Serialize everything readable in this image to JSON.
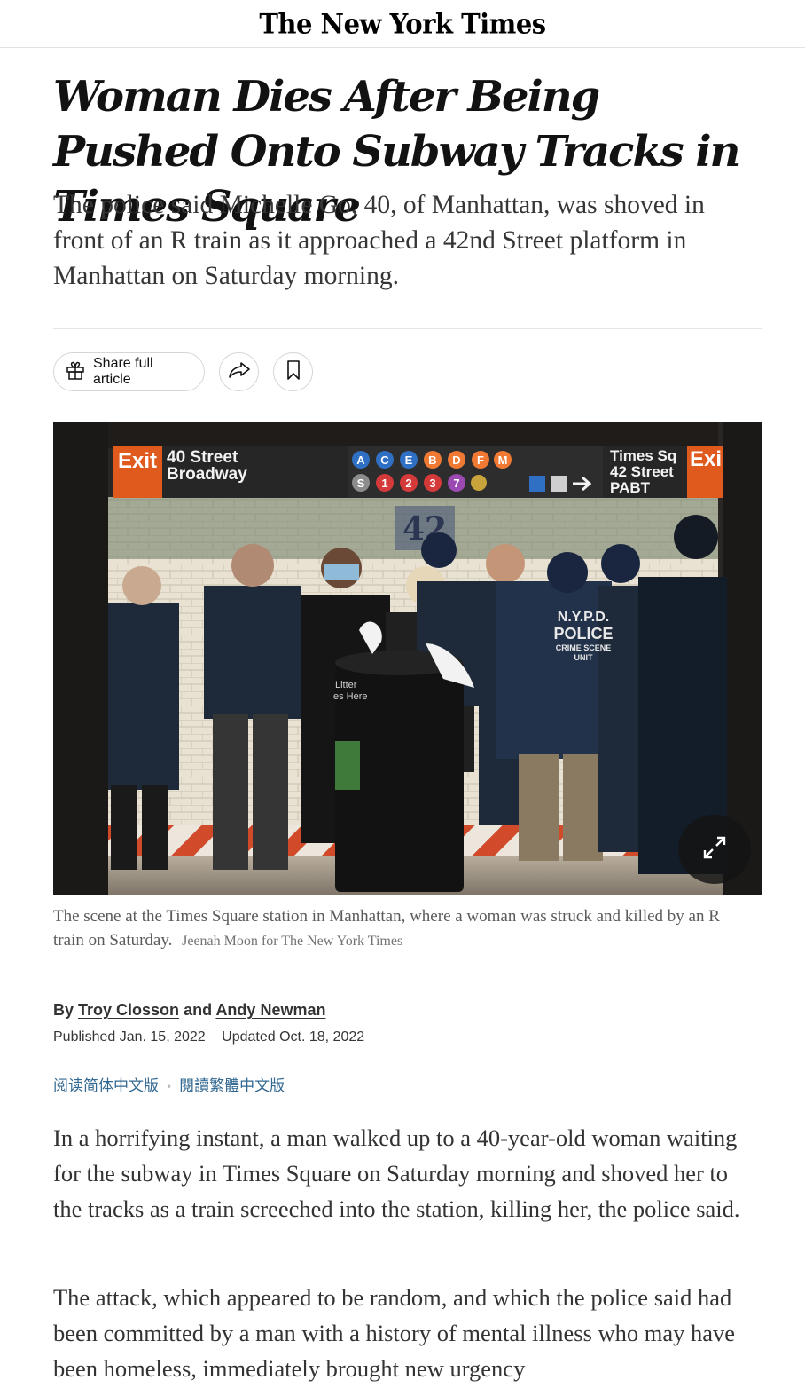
{
  "masthead": {
    "logo_text": "The New York Times"
  },
  "article": {
    "headline": "Woman Dies After Being Pushed Onto Subway Tracks in Times Square",
    "summary": "The police said Michelle Go, 40, of Manhattan, was shoved in front of an R train as it approached a 42nd Street platform in Manhattan on Saturday morning.",
    "caption": "The scene at the Times Square station in Manhattan, where a woman was struck and killed by an R train on Saturday.",
    "credit": "Jeenah Moon for The New York Times",
    "byline": {
      "prefix": "By",
      "author1": "Troy Closson",
      "conj": "and",
      "author2": "Andy Newman"
    },
    "published": "Published Jan. 15, 2022",
    "updated": "Updated Oct. 18, 2022",
    "translations": {
      "simplified": "阅读简体中文版",
      "traditional": "閱讀繁體中文版"
    },
    "paragraphs": [
      "In a horrifying instant, a man walked up to a 40-year-old woman waiting for the subway in Times Square on Saturday morning and shoved her to the tracks as a train screeched into the station, killing her, the police said.",
      "The attack, which appeared to be random, and which the police said had been committed by a man with a history of mental illness who may have been homeless, immediately brought new urgency"
    ]
  },
  "toolbar": {
    "share_label": "Share full article",
    "share_icon": "gift-icon",
    "forward_icon": "share-arrow-icon",
    "save_icon": "bookmark-icon"
  },
  "photo": {
    "sign_left_exit": "Exit",
    "sign_left_street": "40 Street",
    "sign_left_avenue": "Broadway",
    "sign_right_line1": "Times Sq",
    "sign_right_line2": "42 Street",
    "sign_right_line3": "PABT",
    "sign_right_exit": "Exi",
    "lines_top": [
      "A",
      "C",
      "E",
      "B",
      "D",
      "F",
      "M"
    ],
    "lines_bottom": [
      "S",
      "1",
      "2",
      "3",
      "7"
    ],
    "tile_number": "42",
    "jacket_text1": "N.Y.P.D.",
    "jacket_text2": "POLICE",
    "jacket_text3": "CRIME SCENE",
    "jacket_text4": "UNIT",
    "bin_text1": "Litter",
    "bin_text2": "es Here"
  },
  "colors": {
    "link_blue": "#326891",
    "sign_orange": "#e05a1e",
    "line_blue": "#2f6fc4",
    "line_orange": "#f07a33",
    "line_red": "#d53a3a",
    "line_purple": "#9a4ab0",
    "line_gray": "#8c8c8c"
  }
}
